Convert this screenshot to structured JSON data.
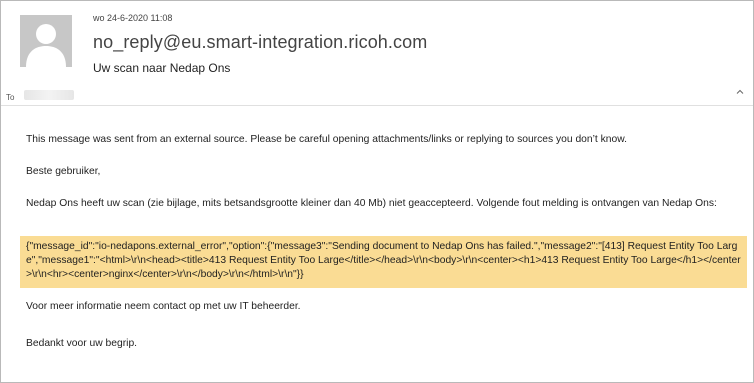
{
  "header": {
    "date": "wo 24-6-2020 11:08",
    "sender": "no_reply@eu.smart-integration.ricoh.com",
    "subject": "Uw scan naar Nedap Ons",
    "to_label": "To",
    "collapse_icon": "chevron-up-icon"
  },
  "message": {
    "external_warning": "This message was sent from an external source. Please be careful opening attachments/links or replying to sources you don’t know.",
    "greeting": "Beste gebruiker,",
    "intro": "Nedap Ons heeft uw scan (zie bijlage, mits betsandsgrootte kleiner dan 40 Mb) niet geaccepteerd. Volgende fout melding is ontvangen van Nedap Ons:",
    "error_json": "{\"message_id\":\"io-nedapons.external_error\",\"option\":{\"message3\":\"Sending document to Nedap Ons has failed.\",\"message2\":\"[413] Request Entity Too Large\",\"message1\":\"<html>\\r\\n<head><title>413 Request Entity Too Large</title></head>\\r\\n<body>\\r\\n<center><h1>413 Request Entity Too Large</h1></center>\\r\\n<hr><center>nginx</center>\\r\\n</body>\\r\\n</html>\\r\\n\"}}",
    "more_info": "Voor meer informatie neem contact op met uw IT beheerder.",
    "thanks": "Bedankt voor uw begrip."
  },
  "colors": {
    "highlight": "#fadc94",
    "avatar_bg": "#c7c7c7"
  }
}
